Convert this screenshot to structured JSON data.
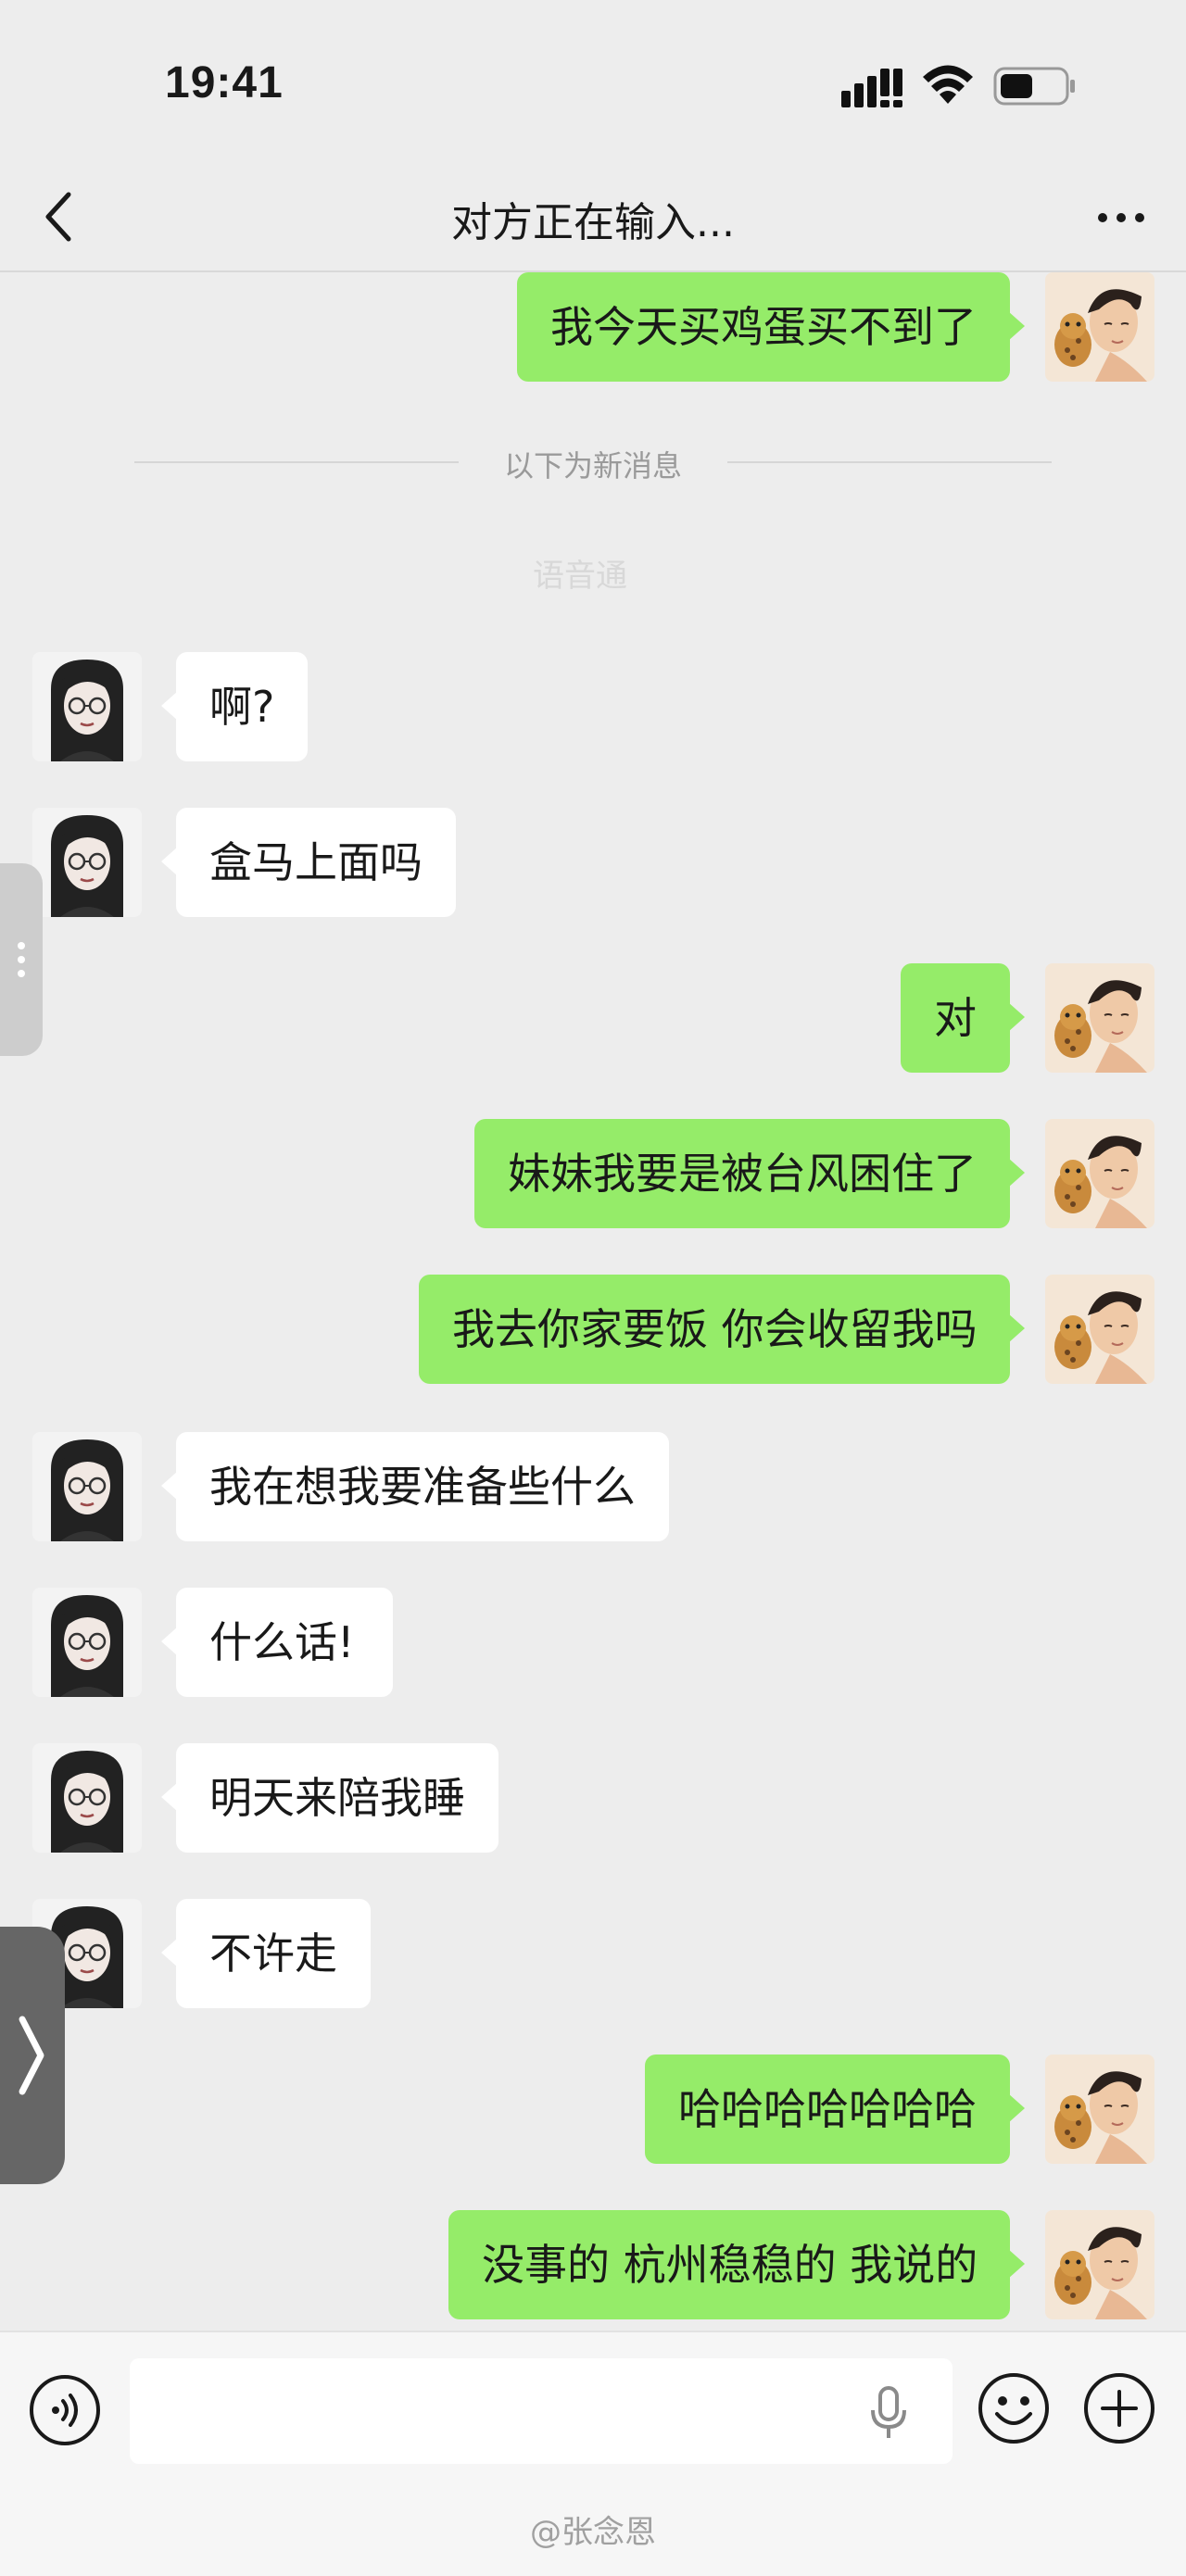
{
  "status_bar": {
    "time": "19:41"
  },
  "nav": {
    "title": "对方正在输入..."
  },
  "chat": {
    "divider_text": "以下为新消息",
    "ghost_text": "语音通",
    "messages": [
      {
        "side": "out",
        "text": "我今天买鸡蛋买不到了"
      },
      {
        "side": "in",
        "text": "啊?"
      },
      {
        "side": "in",
        "text": "盒马上面吗"
      },
      {
        "side": "out",
        "text": "对"
      },
      {
        "side": "out",
        "text": "妹妹我要是被台风困住了"
      },
      {
        "side": "out",
        "text": "我去你家要饭 你会收留我吗"
      },
      {
        "side": "in",
        "text": "我在想我要准备些什么"
      },
      {
        "side": "in",
        "text": "什么话!"
      },
      {
        "side": "in",
        "text": "明天来陪我睡"
      },
      {
        "side": "in",
        "text": "不许走"
      },
      {
        "side": "out",
        "text": "哈哈哈哈哈哈哈"
      },
      {
        "side": "out",
        "text": "没事的 杭州稳稳的 我说的"
      }
    ]
  },
  "input_bar": {
    "placeholder": ""
  },
  "watermark": "@张念恩",
  "colors": {
    "outgoing_bubble": "#95ec69",
    "incoming_bubble": "#ffffff",
    "background": "#ededed"
  }
}
